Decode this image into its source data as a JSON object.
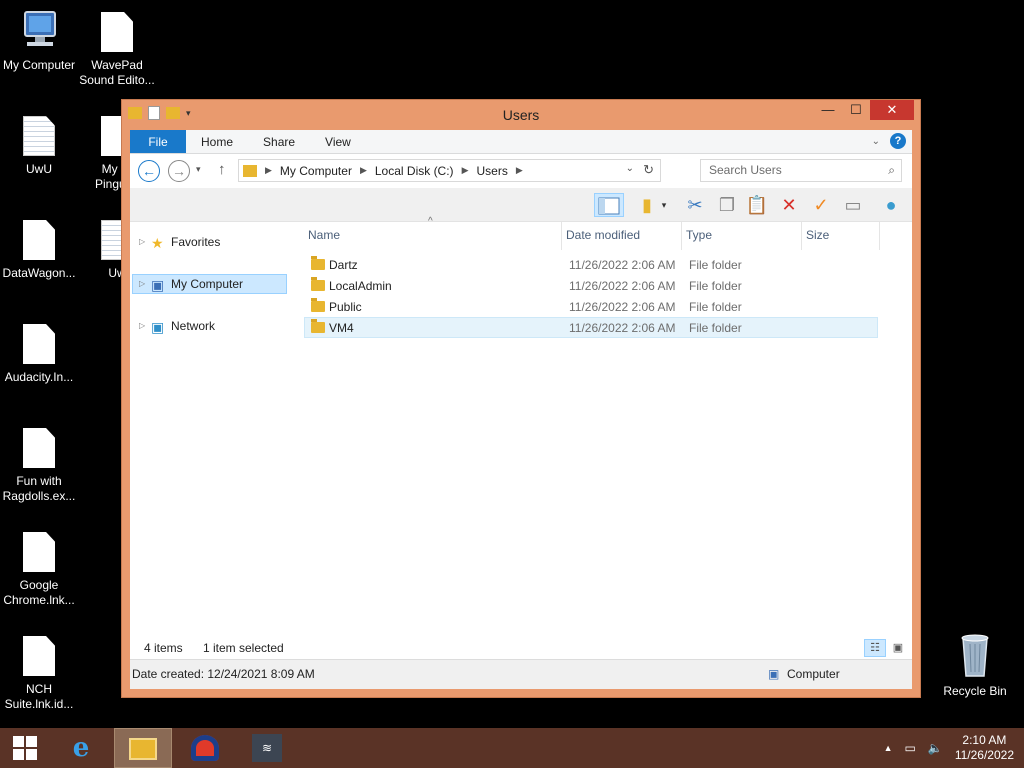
{
  "desktop": {
    "icons": [
      {
        "label": "My Computer"
      },
      {
        "label": "WavePad\nSound Edito..."
      },
      {
        "label": "UwU"
      },
      {
        "label": "My Fr\nPingu.In"
      },
      {
        "label": "DataWagon..."
      },
      {
        "label": "Uw"
      },
      {
        "label": "Audacity.In..."
      },
      {
        "label": "Fun with\nRagdolls.ex..."
      },
      {
        "label": "Google\nChrome.lnk..."
      },
      {
        "label": "NCH\nSuite.lnk.id..."
      },
      {
        "label": "Recycle Bin"
      }
    ]
  },
  "window": {
    "title": "Users",
    "ribbon_tabs": [
      "File",
      "Home",
      "Share",
      "View"
    ],
    "address": {
      "crumbs": [
        "My Computer",
        "Local Disk (C:)",
        "Users"
      ]
    },
    "search_placeholder": "Search Users",
    "nav": {
      "items": [
        {
          "label": "Favorites",
          "icon": "star-icon",
          "selected": false
        },
        {
          "label": "My Computer",
          "icon": "computer-icon",
          "selected": true
        },
        {
          "label": "Network",
          "icon": "network-icon",
          "selected": false
        }
      ]
    },
    "columns": [
      "Name",
      "Date modified",
      "Type",
      "Size"
    ],
    "rows": [
      {
        "name": "Dartz",
        "date": "11/26/2022 2:06 AM",
        "type": "File folder"
      },
      {
        "name": "LocalAdmin",
        "date": "11/26/2022 2:06 AM",
        "type": "File folder"
      },
      {
        "name": "Public",
        "date": "11/26/2022 2:06 AM",
        "type": "File folder"
      },
      {
        "name": "VM4",
        "date": "11/26/2022 2:06 AM",
        "type": "File folder",
        "selected": true
      }
    ],
    "status": {
      "items_count": "4 items",
      "selected_count": "1 item selected"
    },
    "details": {
      "date_created": "Date created: 12/24/2021 8:09 AM",
      "location": "Computer"
    }
  },
  "taskbar": {
    "time": "2:10 AM",
    "date": "11/26/2022"
  },
  "colors": {
    "window_frame": "#e99a6e",
    "close_button": "#c7372f",
    "file_tab": "#1979ca",
    "taskbar": "#5a3326",
    "selection": "#cce8ff"
  }
}
